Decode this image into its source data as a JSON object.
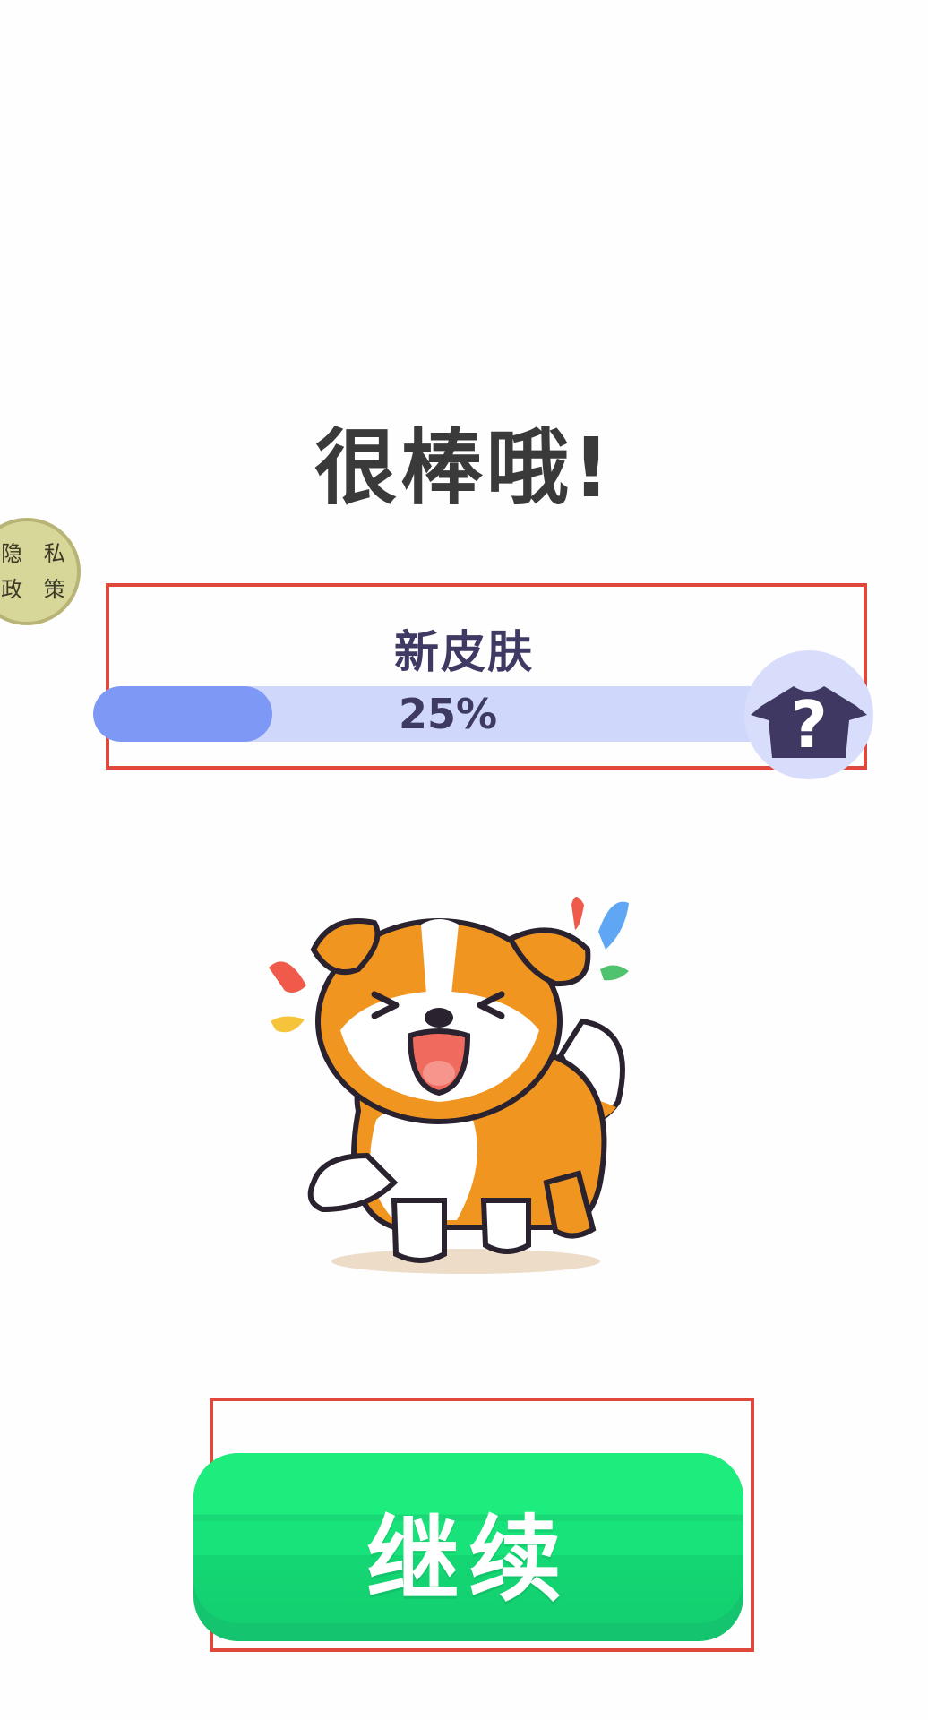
{
  "screen": {
    "headline": "很棒哦!",
    "privacy_badge": {
      "line1": "隐 私",
      "line2": "政 策"
    },
    "reward": {
      "title": "新皮肤",
      "progress_text": "25%",
      "progress_fraction": 0.25,
      "locked_item_icon": "mystery-shirt-question-icon"
    },
    "mascot_icon": "happy-dog-illustration",
    "continue_button": {
      "label": "继续"
    }
  },
  "colors": {
    "progress_fill": "#7e98f6",
    "progress_track": "#cfd8fb",
    "button_green": "#1ded7d",
    "highlight_red": "#e0483b"
  }
}
